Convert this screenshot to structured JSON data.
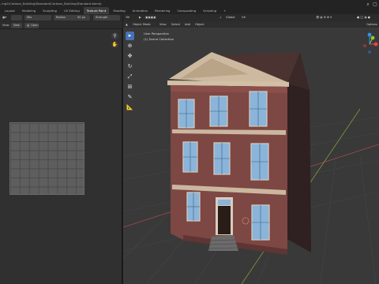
{
  "titlebar": {
    "path": "..ing2\\Cartoon_Building\\Standard\\Cartoon_Building(Standard.blend)"
  },
  "workspace_tabs": [
    "Layout",
    "Modeling",
    "Sculpting",
    "UV Editing",
    "Texture Paint",
    "Shading",
    "Animation",
    "Rendering",
    "Compositing",
    "Scripting"
  ],
  "active_tab": "Texture Paint",
  "uv_editor": {
    "mode": "Mix",
    "brush_label": "Radius",
    "radius_value": "50 px",
    "strength_label": "Strength",
    "view_label": "View",
    "new_label": "New",
    "open_label": "Open"
  },
  "viewport": {
    "mode": "Object Mode",
    "menus": [
      "View",
      "Select",
      "Add",
      "Object"
    ],
    "orientation": "Global",
    "options_label": "Options",
    "info_line1": "User Perspective",
    "info_line2": "(1) Scene Collection"
  },
  "colors": {
    "brick": "#7d4744",
    "trim": "#cbb79f",
    "window_glass": "#8ab4d9",
    "active_tool": "#4772b3",
    "axis_x": "#e8454c",
    "axis_y": "#8ccd3a",
    "axis_z": "#3d8de8"
  }
}
